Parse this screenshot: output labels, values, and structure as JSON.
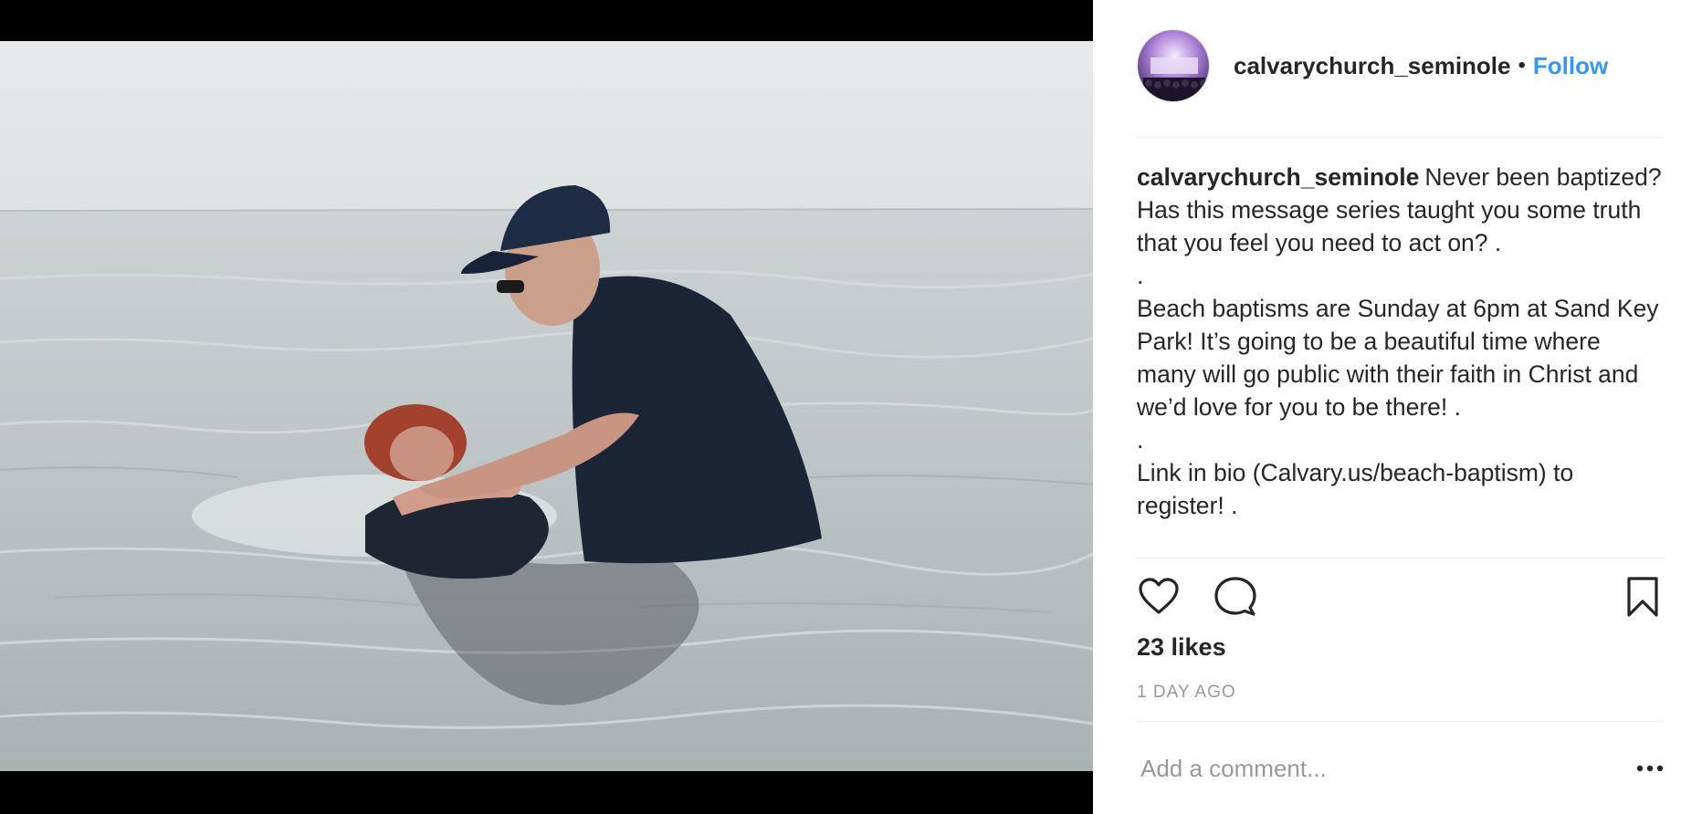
{
  "post": {
    "username": "calvarychurch_seminole",
    "separator": "•",
    "follow_label": "Follow"
  },
  "caption": {
    "username": "calvarychurch_seminole",
    "lines": [
      "Never been baptized? Has this message series taught you some truth that you feel you need to act on? .",
      ".",
      "Beach baptisms are Sunday at 6pm at Sand Key Park! It’s going to be a beautiful time where many will go public with their faith in Christ and we’d love for you to be there! .",
      ".",
      "Link in bio (Calvary.us/beach-baptism) to register! ."
    ]
  },
  "engagement": {
    "likes": "23 likes",
    "timestamp": "1 DAY AGO"
  },
  "comment": {
    "placeholder": "Add a comment..."
  },
  "icons": {
    "like": "heart-icon",
    "comment": "comment-bubble-icon",
    "save": "bookmark-icon",
    "more": "more-options-icon"
  },
  "colors": {
    "link": "#3897f0",
    "text": "#262626",
    "muted": "#999999",
    "divider": "#efefef"
  }
}
